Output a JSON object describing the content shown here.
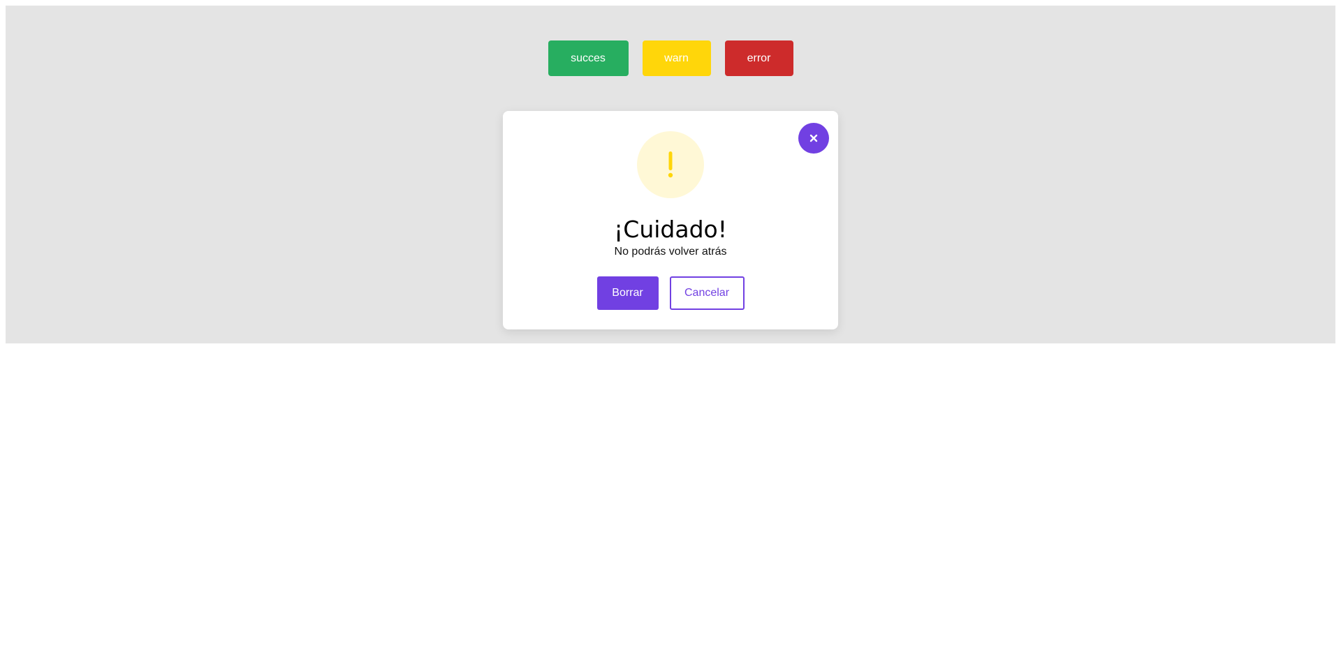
{
  "triggers": {
    "success_label": "succes",
    "warn_label": "warn",
    "error_label": "error"
  },
  "modal": {
    "icon": "exclamation-icon",
    "title": "¡Cuidado!",
    "text": "No podrás volver atrás",
    "confirm_label": "Borrar",
    "cancel_label": "Cancelar",
    "close_icon": "close-icon"
  },
  "colors": {
    "success": "#27ae60",
    "warn": "#ffd60a",
    "error": "#cd2b2b",
    "accent": "#7140e2",
    "warn_icon_bg": "#fff8d6",
    "backdrop": "#e4e4e4"
  }
}
